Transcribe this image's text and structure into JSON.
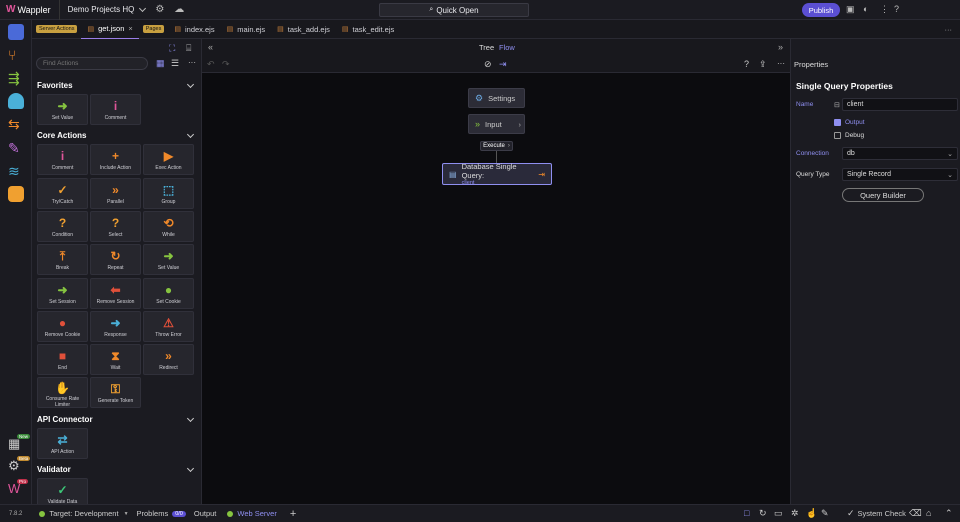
{
  "app": {
    "name": "Wappler",
    "project": "Demo Projects HQ",
    "quick_open": "Quick Open",
    "publish": "Publish"
  },
  "tabs": {
    "server_actions_pill": "Server Actions",
    "pages_pill": "Pages",
    "items": [
      {
        "label": "get.json",
        "close": "×"
      },
      {
        "label": "index.ejs"
      },
      {
        "label": "main.ejs"
      },
      {
        "label": "task_add.ejs"
      },
      {
        "label": "task_edit.ejs"
      }
    ],
    "more": "···"
  },
  "left": {
    "find_placeholder": "Find Actions",
    "sections": [
      {
        "title": "Favorites",
        "items": [
          {
            "label": "Set Value",
            "icon": "arrow-right-icon",
            "glyph": "➜",
            "color": "#86c440"
          },
          {
            "label": "Comment",
            "icon": "info-icon",
            "glyph": "i",
            "color": "#e0559a"
          }
        ]
      },
      {
        "title": "Core Actions",
        "items": [
          {
            "label": "Comment",
            "icon": "info-icon",
            "glyph": "i",
            "color": "#e0559a"
          },
          {
            "label": "Include Action",
            "icon": "plus-circle-icon",
            "glyph": "+",
            "color": "#f0892a"
          },
          {
            "label": "Exec Action",
            "icon": "play-icon",
            "glyph": "▶",
            "color": "#f0892a"
          },
          {
            "label": "Try/Catch",
            "icon": "check-circle-icon",
            "glyph": "✓",
            "color": "#f0a030"
          },
          {
            "label": "Parallel",
            "icon": "double-chevron-icon",
            "glyph": "»",
            "color": "#f0892a"
          },
          {
            "label": "Group",
            "icon": "group-icon",
            "glyph": "⬚",
            "color": "#4ab0d8"
          },
          {
            "label": "Condition",
            "icon": "question-icon",
            "glyph": "?",
            "color": "#f0a030"
          },
          {
            "label": "Select",
            "icon": "question-icon",
            "glyph": "?",
            "color": "#f0a030"
          },
          {
            "label": "While",
            "icon": "loop-icon",
            "glyph": "⟲",
            "color": "#f0892a"
          },
          {
            "label": "Break",
            "icon": "arrow-up-icon",
            "glyph": "⤒",
            "color": "#f0892a"
          },
          {
            "label": "Repeat",
            "icon": "repeat-icon",
            "glyph": "↻",
            "color": "#f0892a"
          },
          {
            "label": "Set Value",
            "icon": "arrow-right-icon",
            "glyph": "➜",
            "color": "#86c440"
          },
          {
            "label": "Set Session",
            "icon": "arrow-right-icon",
            "glyph": "➜",
            "color": "#86c440"
          },
          {
            "label": "Remove Session",
            "icon": "arrow-left-icon",
            "glyph": "⬅",
            "color": "#e0503a"
          },
          {
            "label": "Set Cookie",
            "icon": "cookie-icon",
            "glyph": "●",
            "color": "#86c440"
          },
          {
            "label": "Remove Cookie",
            "icon": "cookie-icon",
            "glyph": "●",
            "color": "#e0503a"
          },
          {
            "label": "Response",
            "icon": "arrow-right-icon",
            "glyph": "➜",
            "color": "#4ab0d8"
          },
          {
            "label": "Throw Error",
            "icon": "warning-icon",
            "glyph": "⚠",
            "color": "#e0503a"
          },
          {
            "label": "End",
            "icon": "stop-icon",
            "glyph": "■",
            "color": "#e0503a"
          },
          {
            "label": "Wait",
            "icon": "hourglass-icon",
            "glyph": "⧗",
            "color": "#f0892a"
          },
          {
            "label": "Redirect",
            "icon": "double-chevron-icon",
            "glyph": "»",
            "color": "#f0892a"
          },
          {
            "label": "Consume Rate Limiter",
            "icon": "hand-icon",
            "glyph": "✋",
            "color": "#f0a030"
          },
          {
            "label": "Generate Token",
            "icon": "key-icon",
            "glyph": "⚿",
            "color": "#f0a030"
          }
        ]
      },
      {
        "title": "API Connector",
        "items": [
          {
            "label": "API Action",
            "icon": "exchange-icon",
            "glyph": "⇄",
            "color": "#4ab0d8"
          }
        ]
      },
      {
        "title": "Validator",
        "items": [
          {
            "label": "Validate Data",
            "icon": "check-icon",
            "glyph": "✓",
            "color": "#3cc878"
          }
        ]
      }
    ]
  },
  "center": {
    "view_tree": "Tree",
    "view_flow": "Flow",
    "node_settings": "Settings",
    "node_input": "Input",
    "execute": "Execute",
    "node_query_title": "Database Single Query:",
    "node_query_sub": "client"
  },
  "right": {
    "header": "Properties",
    "title": "Single Query Properties",
    "name_label": "Name",
    "name_value": "client",
    "output_label": "Output",
    "output_checked": true,
    "debug_label": "Debug",
    "debug_checked": false,
    "connection_label": "Connection",
    "connection_value": "db",
    "query_type_label": "Query Type",
    "query_type_value": "Single Record",
    "query_builder": "Query Builder"
  },
  "status": {
    "version": "7.8.2",
    "target_label": "Target: Development",
    "problems_label": "Problems",
    "problems_count": "0/0",
    "output_label": "Output",
    "web_server_label": "Web Server",
    "system_check": "System Check"
  },
  "rail": {
    "badge_new": "New",
    "badge_beta": "Beta",
    "badge_pro": "Pro"
  }
}
